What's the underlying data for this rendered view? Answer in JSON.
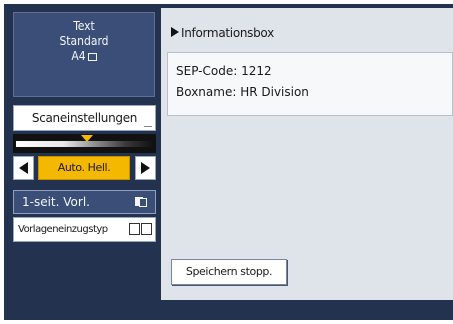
{
  "status": {
    "line1": "Text",
    "line2": "Standard",
    "paper": "A4"
  },
  "scan_settings_label": "Scaneinstellungen",
  "density": {
    "level": 0.52,
    "left_icon": "triangle-left-icon",
    "right_icon": "triangle-right-icon",
    "auto_label": "Auto. Hell."
  },
  "duplex_label": "1-seit. Vorl.",
  "feed_type_label": "Vorlageneinzugstyp",
  "info": {
    "title": "Informationsbox",
    "sep_code": "SEP-Code: 1212",
    "box_name": "Boxname: HR Division"
  },
  "stop_button_label": "Speichern stopp.",
  "colors": {
    "frame": "#23324f",
    "panel": "#3a4e78",
    "accent": "#f5b800",
    "content_bg": "#dfe3ea"
  }
}
